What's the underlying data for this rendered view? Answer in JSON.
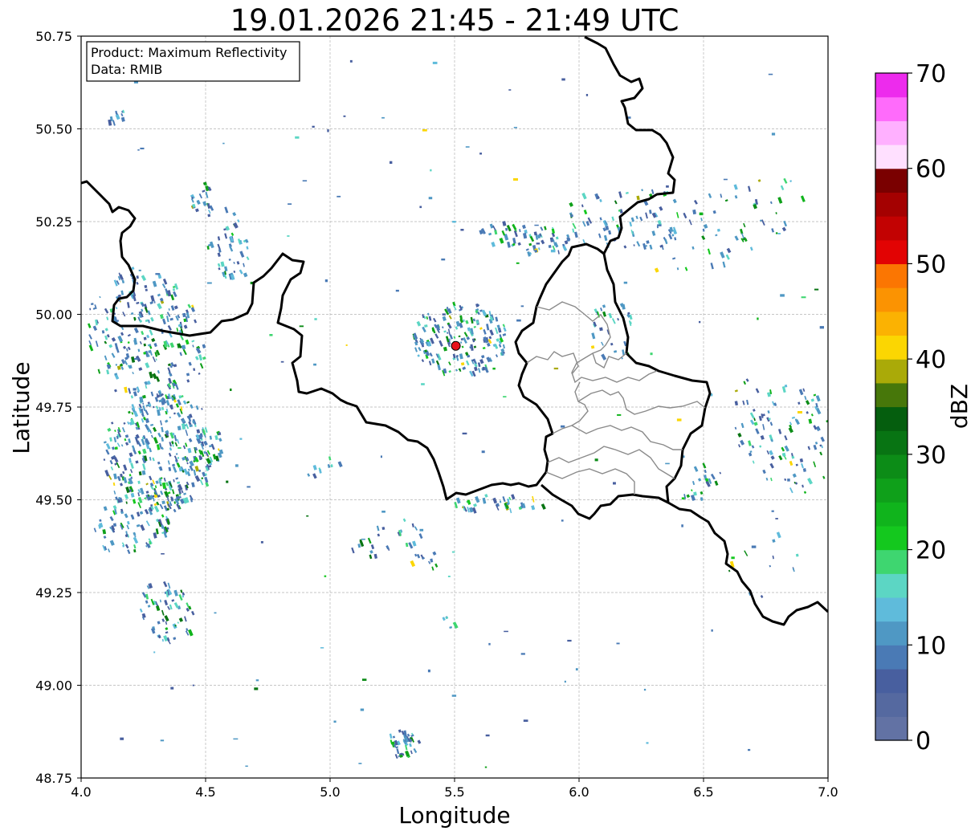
{
  "title": "19.01.2026 21:45 - 21:49 UTC",
  "info_box": {
    "product_line": "Product: Maximum Reflectivity",
    "data_line": "Data: RMIB"
  },
  "map": {
    "xlabel": "Longitude",
    "ylabel": "Latitude",
    "xlim": [
      4.0,
      7.0
    ],
    "ylim": [
      48.75,
      50.75
    ],
    "x_ticks": [
      "4.0",
      "4.5",
      "5.0",
      "5.5",
      "6.0",
      "6.5",
      "7.0"
    ],
    "y_ticks": [
      "50.75",
      "50.50",
      "50.25",
      "50.00",
      "49.75",
      "49.50",
      "49.25",
      "49.00",
      "48.75"
    ],
    "grid": true,
    "radar_site": {
      "lon": 5.505,
      "lat": 49.915,
      "color": "#e8101a"
    }
  },
  "colorbar": {
    "label": "dBZ",
    "ticks": [
      "0",
      "10",
      "20",
      "30",
      "40",
      "50",
      "60",
      "70"
    ],
    "range": [
      0,
      70
    ],
    "step": 2.5,
    "colors": [
      "#6272a4",
      "#5569a0",
      "#485f9f",
      "#4a7ab5",
      "#4f98c4",
      "#5fbbdb",
      "#5cd6c4",
      "#3ed670",
      "#14c81e",
      "#10b41c",
      "#0fa01a",
      "#0c8c17",
      "#087413",
      "#055e0e",
      "#47770a",
      "#aaaa08",
      "#fbd602",
      "#fbb202",
      "#fb9302",
      "#fb7602",
      "#e20303",
      "#c20202",
      "#a40101",
      "#7a0000",
      "#ffe0ff",
      "#ffb0ff",
      "#ff6bfb",
      "#ed2bed"
    ]
  },
  "chart_data": {
    "type": "map",
    "product": "Maximum Reflectivity",
    "source": "RMIB",
    "time_range": "19.01.2026 21:45 - 21:49 UTC",
    "value_unit": "dBZ",
    "lon_range": [
      4.0,
      7.0
    ],
    "lat_range": [
      48.75,
      50.75
    ]
  }
}
